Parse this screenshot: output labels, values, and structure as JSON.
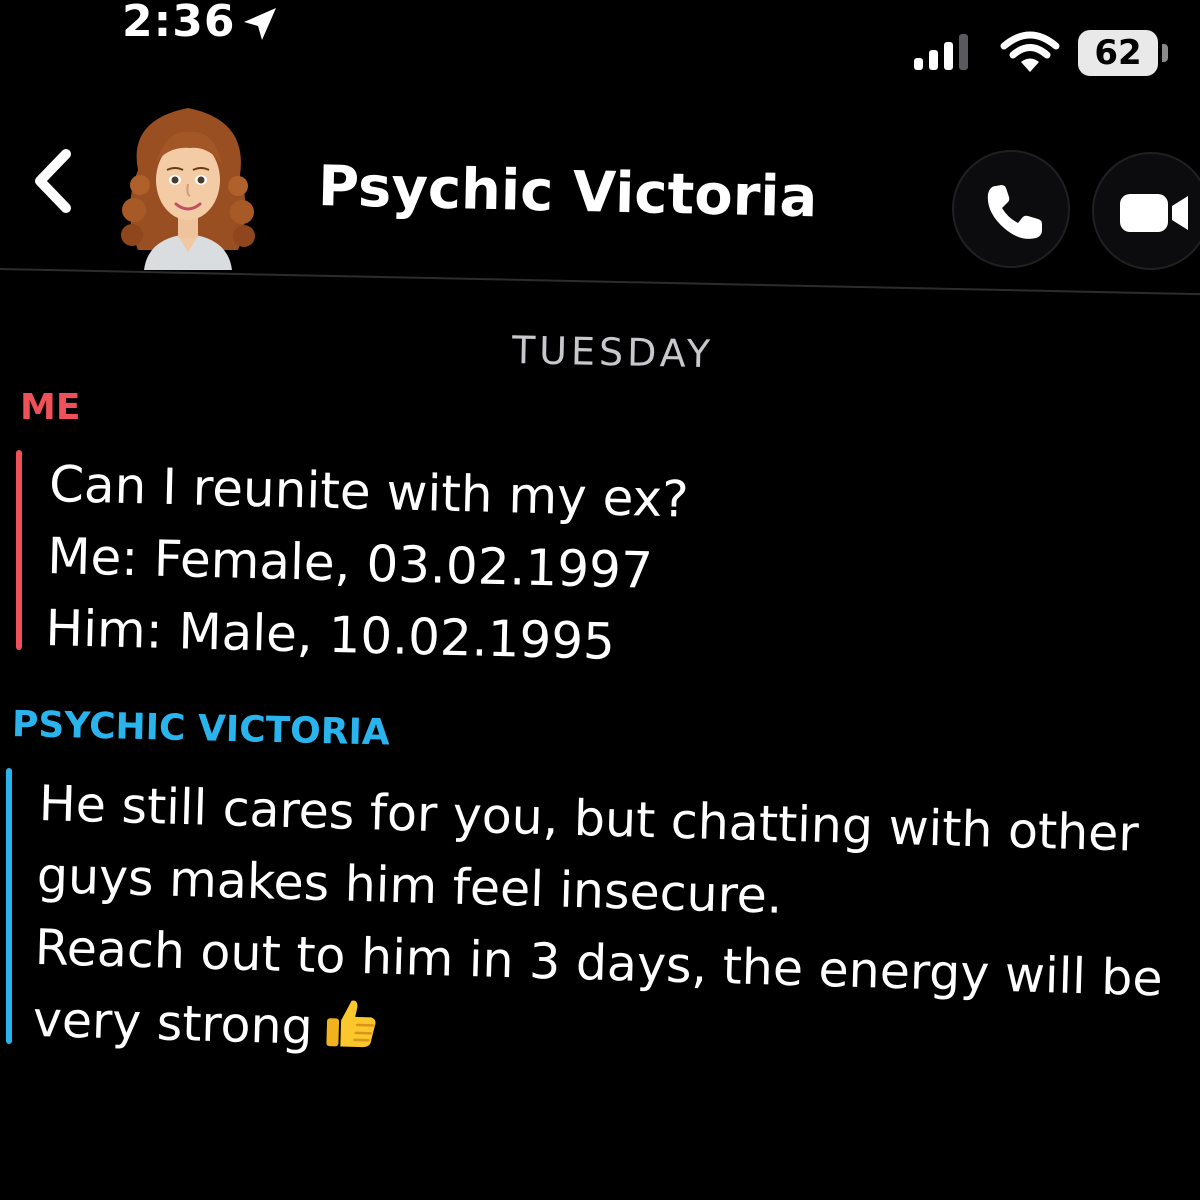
{
  "status_bar": {
    "time": "2:36",
    "battery": "62",
    "icons": [
      "location-arrow-icon",
      "cellular-signal-icon",
      "wifi-icon",
      "battery-icon"
    ]
  },
  "header": {
    "contact_name": "Psychic Victoria",
    "back_icon": "chevron-left-icon",
    "actions": [
      "phone-icon",
      "video-camera-icon"
    ]
  },
  "chat": {
    "day_label": "TUESDAY",
    "messages": [
      {
        "sender": "ME",
        "lines": [
          "Can I reunite with my ex?",
          "Me: Female, 03.02.1997",
          "Him: Male, 10.02.1995"
        ]
      },
      {
        "sender": "PSYCHIC VICTORIA",
        "lines": [
          "He still cares for you, but chatting with other",
          "guys makes him feel insecure.",
          "Reach out to him in 3 days, the energy will be",
          "very strong"
        ],
        "emoji": "thumbs-up-icon"
      }
    ]
  },
  "colors": {
    "background": "#000000",
    "me_accent": "#f0505a",
    "victoria_accent": "#2ab4ee",
    "day_label": "#c7c7cc"
  }
}
